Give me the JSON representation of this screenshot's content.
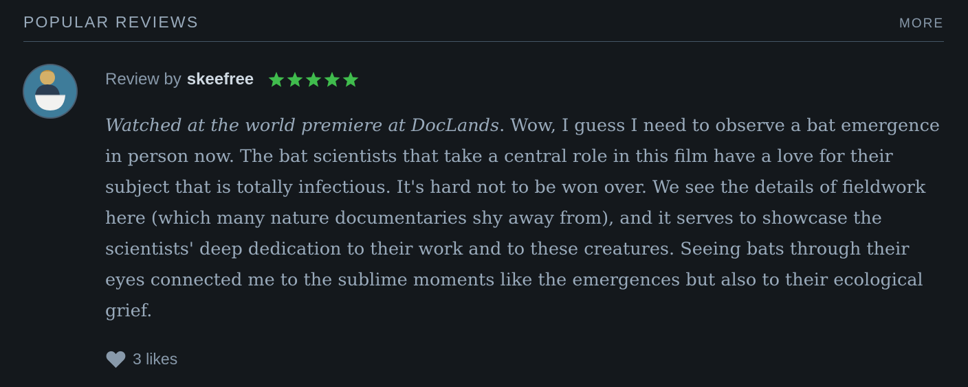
{
  "section": {
    "title": "POPULAR REVIEWS",
    "more_label": "MORE"
  },
  "review": {
    "prefix": "Review by",
    "username": "skeefree",
    "rating_stars": 5,
    "star_color": "#40bc4d",
    "body_italic": "Watched at the world premiere at DocLands",
    "body_rest": ". Wow, I guess I need to observe a bat emergence in person now. The bat scientists that take a central role in this film have a love for their subject that is totally infectious. It's hard not to be won over. We see the details of fieldwork here (which many nature documentaries shy away from), and it serves to showcase the scientists' deep dedication to their work and to these creatures. Seeing bats through their eyes connected me to the sublime moments like the emergences but also to their ecological grief.",
    "likes": "3 likes",
    "like_icon": "heart-icon"
  },
  "colors": {
    "background": "#14181c",
    "text": "#99aabb",
    "username": "#cfd9e2",
    "divider": "#445566"
  }
}
